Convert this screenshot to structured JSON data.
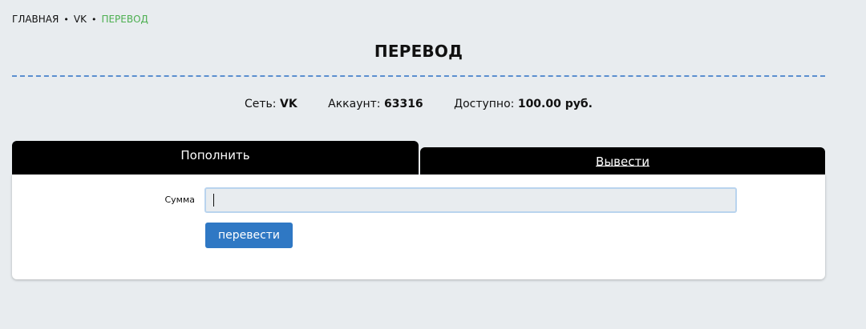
{
  "breadcrumb": {
    "items": [
      "ГЛАВНАЯ",
      "VK",
      "ПЕРЕВОД"
    ],
    "separator": "•"
  },
  "page": {
    "title": "ПЕРЕВОД"
  },
  "info": {
    "network_label": "Сеть:",
    "network_value": "VK",
    "account_label": "Аккаунт:",
    "account_value": "63316",
    "available_label": "Доступно:",
    "available_value": "100.00 руб."
  },
  "tabs": [
    {
      "label": "Пополнить",
      "active": true
    },
    {
      "label": "Вывести",
      "active": false
    }
  ],
  "form": {
    "amount_label": "Сумма",
    "amount_value": "",
    "amount_placeholder": "",
    "submit_label": "перевести"
  },
  "colors": {
    "background": "#e8ecef",
    "accent": "#2f78c4",
    "breadcrumb_current": "#4caf50",
    "divider": "#5b8fd0",
    "tab_bg": "#000000"
  }
}
